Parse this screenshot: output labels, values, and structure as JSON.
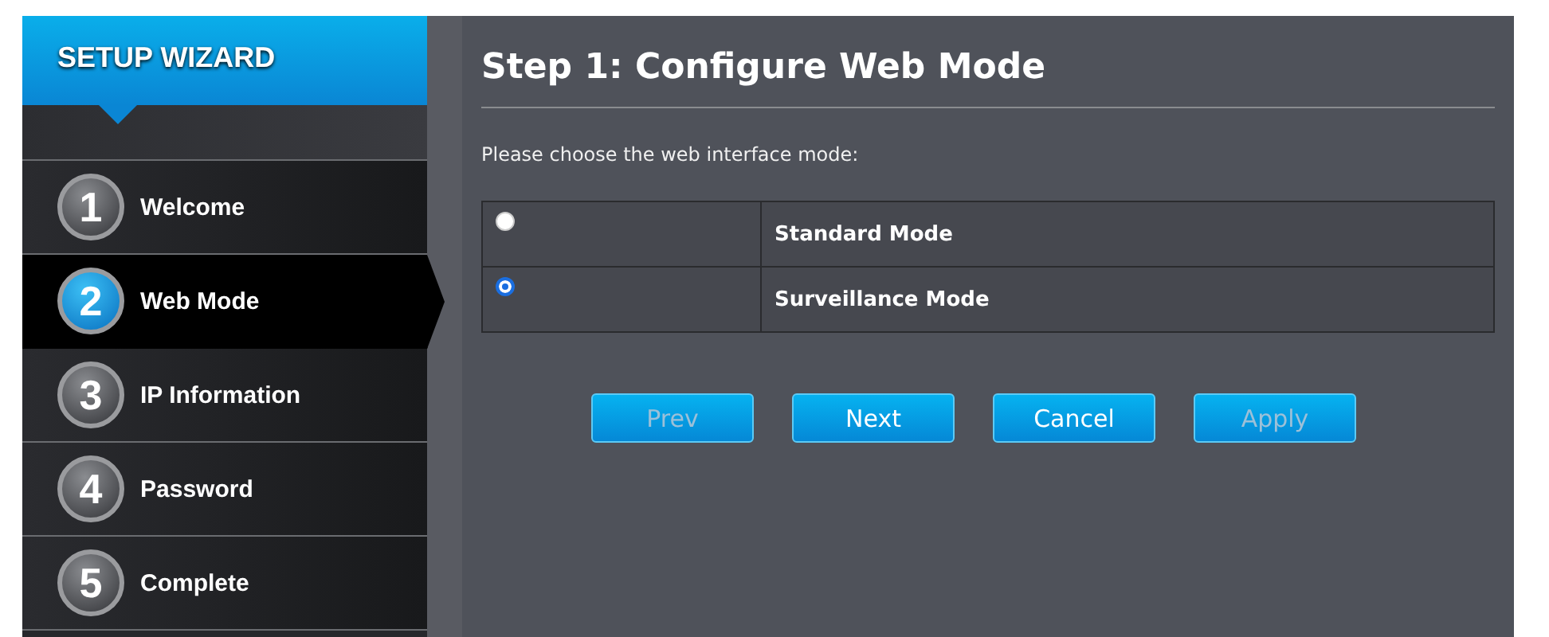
{
  "sidebar": {
    "title": "SETUP WIZARD",
    "steps": [
      {
        "number": "1",
        "label": "Welcome",
        "selected": false
      },
      {
        "number": "2",
        "label": "Web Mode",
        "selected": true
      },
      {
        "number": "3",
        "label": "IP Information",
        "selected": false
      },
      {
        "number": "4",
        "label": "Password",
        "selected": false
      },
      {
        "number": "5",
        "label": "Complete",
        "selected": false
      }
    ]
  },
  "main": {
    "title": "Step 1: Configure Web Mode",
    "prompt": "Please choose the web interface mode:",
    "options": [
      {
        "label": "Standard Mode",
        "selected": false
      },
      {
        "label": "Surveillance Mode",
        "selected": true
      }
    ],
    "buttons": [
      {
        "label": "Prev",
        "disabled": true
      },
      {
        "label": "Next",
        "disabled": false
      },
      {
        "label": "Cancel",
        "disabled": false
      },
      {
        "label": "Apply",
        "disabled": true
      }
    ]
  }
}
